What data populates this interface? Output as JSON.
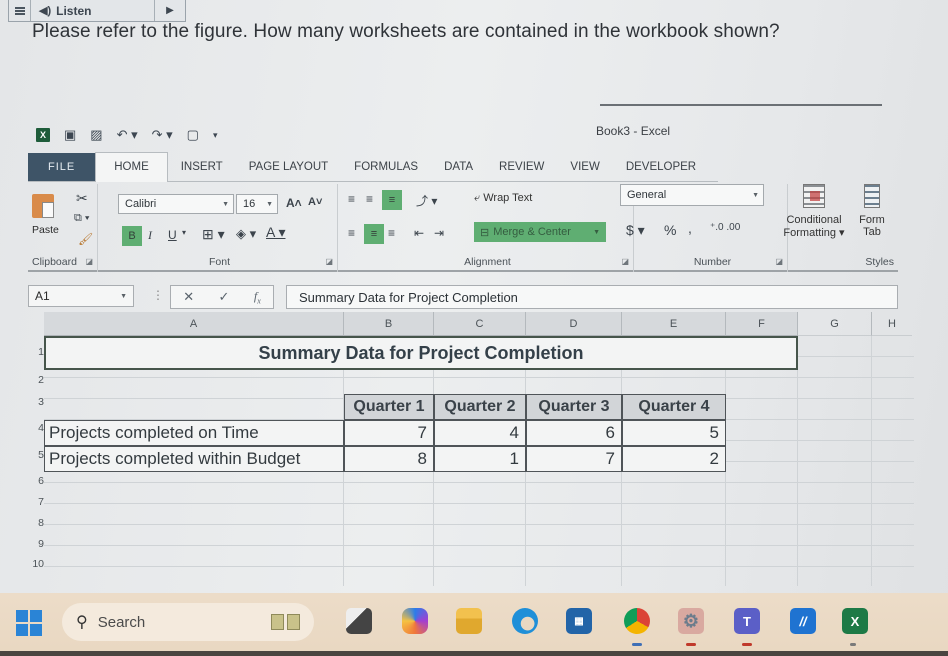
{
  "listen_bar": {
    "label": "Listen"
  },
  "question": {
    "text": "Please refer to the figure.  How many worksheets are contained in the workbook shown?"
  },
  "excel": {
    "window_title": "Book3 - Excel",
    "tabs": [
      "FILE",
      "HOME",
      "INSERT",
      "PAGE LAYOUT",
      "FORMULAS",
      "DATA",
      "REVIEW",
      "VIEW",
      "DEVELOPER"
    ],
    "active_tab": "HOME",
    "ribbon": {
      "clipboard": {
        "paste_label": "Paste",
        "group_label": "Clipboard"
      },
      "font": {
        "font_name": "Calibri",
        "font_size": "16",
        "group_label": "Font",
        "bold": "B",
        "italic": "I",
        "underline": "U"
      },
      "alignment": {
        "wrap_text": "Wrap Text",
        "merge_center": "Merge & Center",
        "group_label": "Alignment"
      },
      "number": {
        "format": "General",
        "currency": "$",
        "percent": "%",
        "comma": ",",
        "group_label": "Number"
      },
      "styles": {
        "conditional_formatting_l1": "Conditional",
        "conditional_formatting_l2": "Formatting",
        "format_table_l1": "Form",
        "format_table_l2": "Tab",
        "group_label": "Styles"
      }
    },
    "formula_bar": {
      "name_box": "A1",
      "content": "Summary Data for Project Completion",
      "fx": "fx"
    },
    "columns": [
      "A",
      "B",
      "C",
      "D",
      "E",
      "F",
      "G",
      "H"
    ],
    "rows": [
      "1",
      "2",
      "3",
      "4",
      "5",
      "6",
      "7",
      "8",
      "9",
      "10"
    ],
    "sheet": {
      "title": "Summary Data for Project Completion",
      "headers": [
        "Quarter 1",
        "Quarter 2",
        "Quarter 3",
        "Quarter 4"
      ],
      "data": [
        {
          "label": "Projects completed on Time",
          "values": [
            "7",
            "4",
            "6",
            "5"
          ]
        },
        {
          "label": "Projects completed within Budget",
          "values": [
            "8",
            "1",
            "7",
            "2"
          ]
        }
      ]
    }
  },
  "taskbar": {
    "search_placeholder": "Search",
    "apps": [
      "task-view",
      "copilot",
      "file-explorer",
      "edge",
      "store",
      "chrome",
      "settings",
      "teams",
      "app",
      "excel"
    ]
  },
  "colors": {
    "accent_green": "#5fae72",
    "file_tab": "#3e5467",
    "header_fill": "#d2d5d8"
  }
}
